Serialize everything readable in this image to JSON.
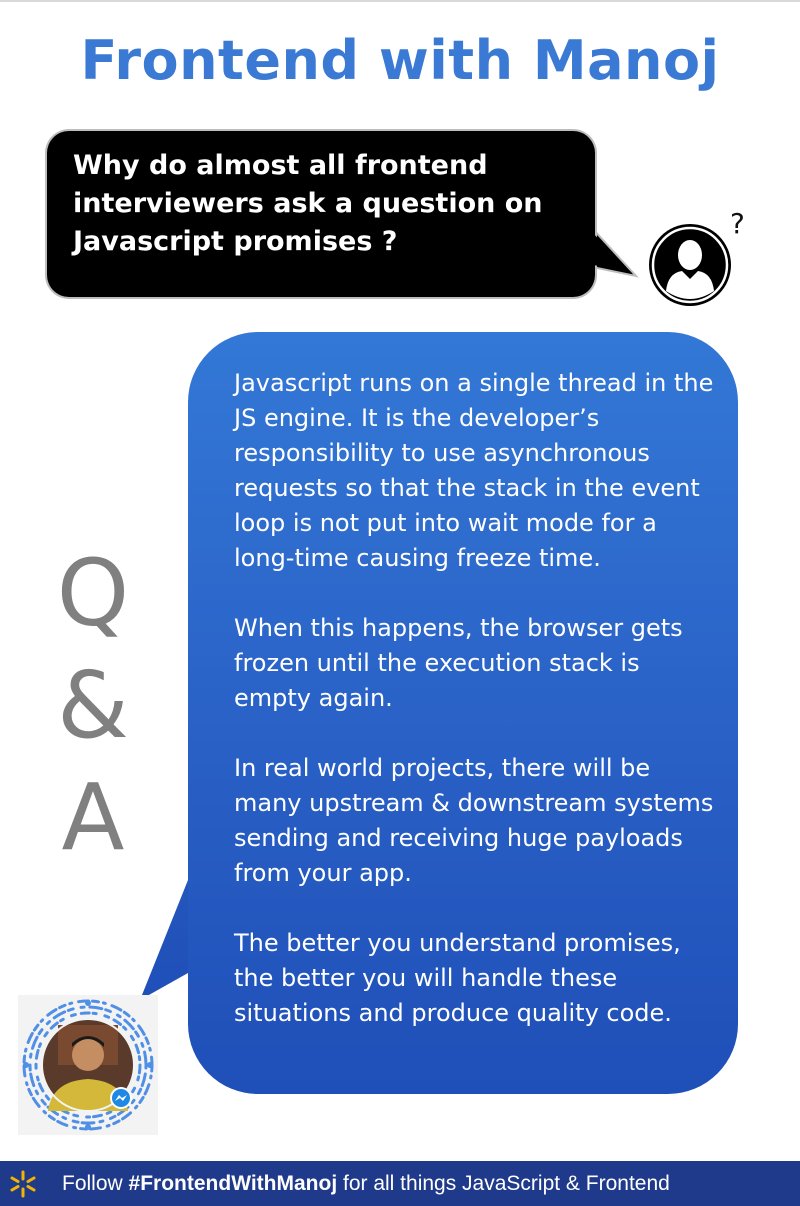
{
  "header": {
    "title": "Frontend with Manoj"
  },
  "question": {
    "lines": [
      "Why do almost all frontend",
      "interviewers ask a question on",
      "Javascript promises ?"
    ],
    "mark": "?",
    "avatar_icon": "user-silhouette-icon"
  },
  "qa_label": {
    "q": "Q",
    "amp": "&",
    "a": "A"
  },
  "answer": {
    "paragraphs": [
      "Javascript runs on a single thread in the JS engine. It is the developer’s responsibility to use asynchronous requests so that the stack in the event loop is not put into wait mode for a long-time causing freeze time.",
      "When this happens, the browser gets frozen until the execution stack is empty again.",
      "In real world projects, there will be many upstream & downstream systems sending and receiving huge payloads from your app.",
      "The better you understand promises, the better you will handle these situations and produce quality code."
    ]
  },
  "messenger_code": {
    "icon": "messenger-code-icon",
    "badge_icon": "messenger-badge-icon"
  },
  "footer": {
    "prefix": "Follow ",
    "hashtag": "#FrontendWithManoj",
    "suffix": " for all things JavaScript & Frontend",
    "icon": "spark-icon"
  },
  "colors": {
    "title": "#3b7ad4",
    "answer_bubble": "#2a62c7",
    "footer_bg": "#1f3a8a",
    "spark": "#f5b400"
  }
}
